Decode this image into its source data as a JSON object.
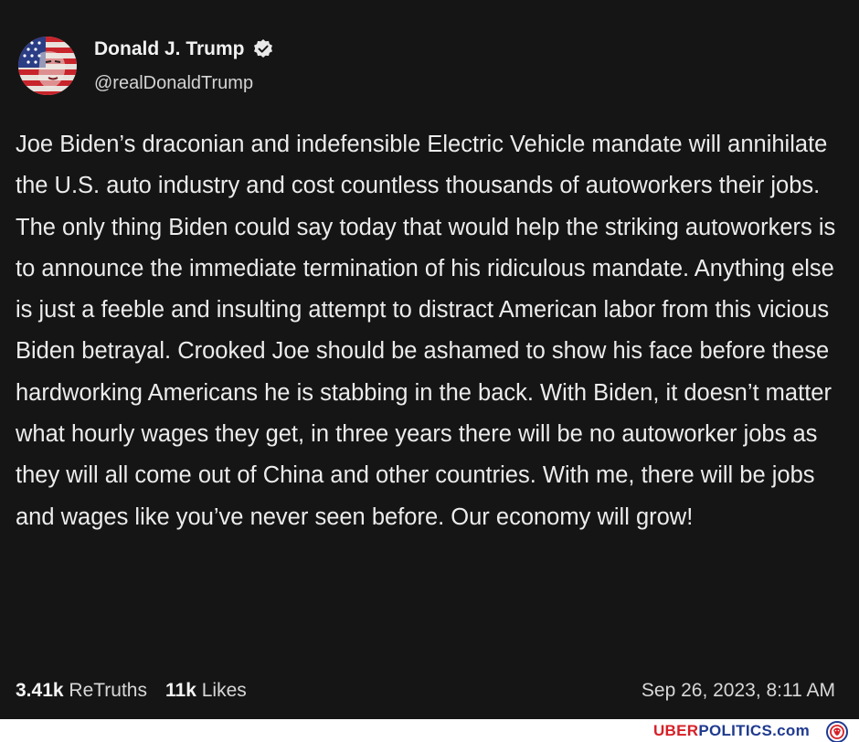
{
  "post": {
    "author_name": "Donald J. Trump",
    "handle": "@realDonaldTrump",
    "text": "Joe Biden’s draconian and indefensible Electric Vehicle mandate will annihilate the U.S. auto industry and cost countless thousands of autoworkers their jobs. The only thing Biden could say today that would help the striking autoworkers is to announce the immediate termination of his ridiculous mandate. Anything else is just a feeble and insulting attempt to distract American labor from this vicious Biden betrayal. Crooked Joe should be ashamed to show his face before these hardworking Americans he is stabbing in the back. With Biden, it doesn’t matter what hourly wages they get, in three years there will be no autoworker jobs as they will all come out of China and other countries. With me, there will be jobs and wages like you’ve never seen before. Our economy will grow!",
    "retruths_count": "3.41k",
    "retruths_label": "ReTruths",
    "likes_count": "11k",
    "likes_label": "Likes",
    "timestamp": "Sep 26, 2023, 8:11 AM"
  },
  "footer": {
    "brand_uber": "UBER",
    "brand_politics": "POLITICS",
    "brand_tld": ".com"
  },
  "icons": {
    "avatar": "american-flag-face-avatar",
    "verified": "verified-badge-icon",
    "brand_logo": "lion-crest-logo"
  },
  "colors": {
    "background": "#151515",
    "text": "#ececec",
    "brand_red": "#d62027",
    "brand_blue": "#1f3a8f"
  }
}
